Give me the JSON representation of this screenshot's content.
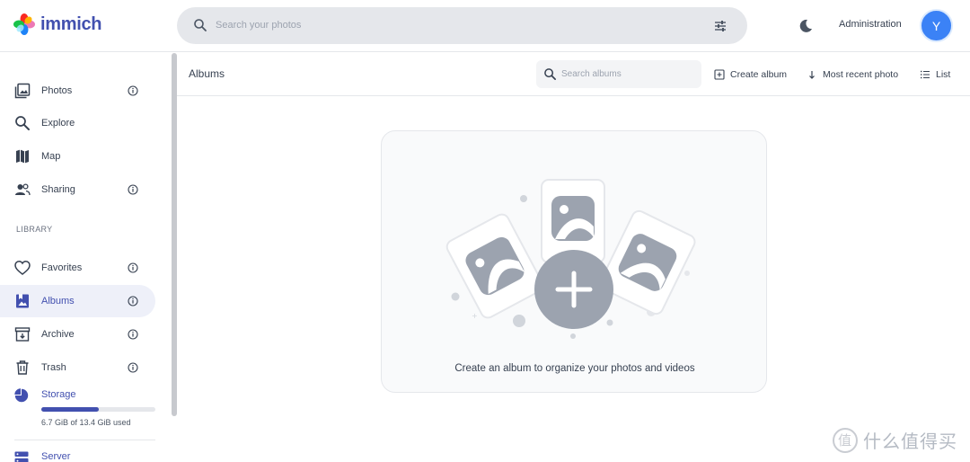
{
  "app": {
    "name": "immich",
    "logo_icon": "immich-pinwheel-icon"
  },
  "header": {
    "search_placeholder": "Search your photos",
    "search_icon": "search-icon",
    "filter_icon": "tune-icon",
    "theme_icon": "moon-icon",
    "admin_label": "Administration",
    "avatar_initial": "Y",
    "avatar_color": "#3b82f6"
  },
  "sidebar": {
    "items": [
      {
        "label": "Photos",
        "icon": "photos-icon",
        "info": true
      },
      {
        "label": "Explore",
        "icon": "magnify-icon",
        "info": false
      },
      {
        "label": "Map",
        "icon": "map-icon",
        "info": false
      },
      {
        "label": "Sharing",
        "icon": "people-icon",
        "info": true
      }
    ],
    "library_label": "LIBRARY",
    "library_items": [
      {
        "label": "Favorites",
        "icon": "heart-icon",
        "info": true
      },
      {
        "label": "Albums",
        "icon": "album-icon",
        "info": true,
        "active": true
      },
      {
        "label": "Archive",
        "icon": "archive-icon",
        "info": true
      },
      {
        "label": "Trash",
        "icon": "trash-icon",
        "info": true
      }
    ],
    "storage": {
      "label": "Storage",
      "usage_text": "6.7 GiB of 13.4 GiB used",
      "used_fraction": 0.5
    },
    "server_label": "Server"
  },
  "main": {
    "title": "Albums",
    "search_placeholder": "Search albums",
    "create_album_label": "Create album",
    "sort_label": "Most recent photo",
    "view_label": "List",
    "empty_message": "Create an album to organize your photos and videos"
  },
  "watermark": {
    "text": "什么值得买",
    "icon_glyph": "值"
  },
  "colors": {
    "accent": "#4250af",
    "active_bg": "#eef0f9",
    "illustration_gray": "#9ca3af"
  }
}
